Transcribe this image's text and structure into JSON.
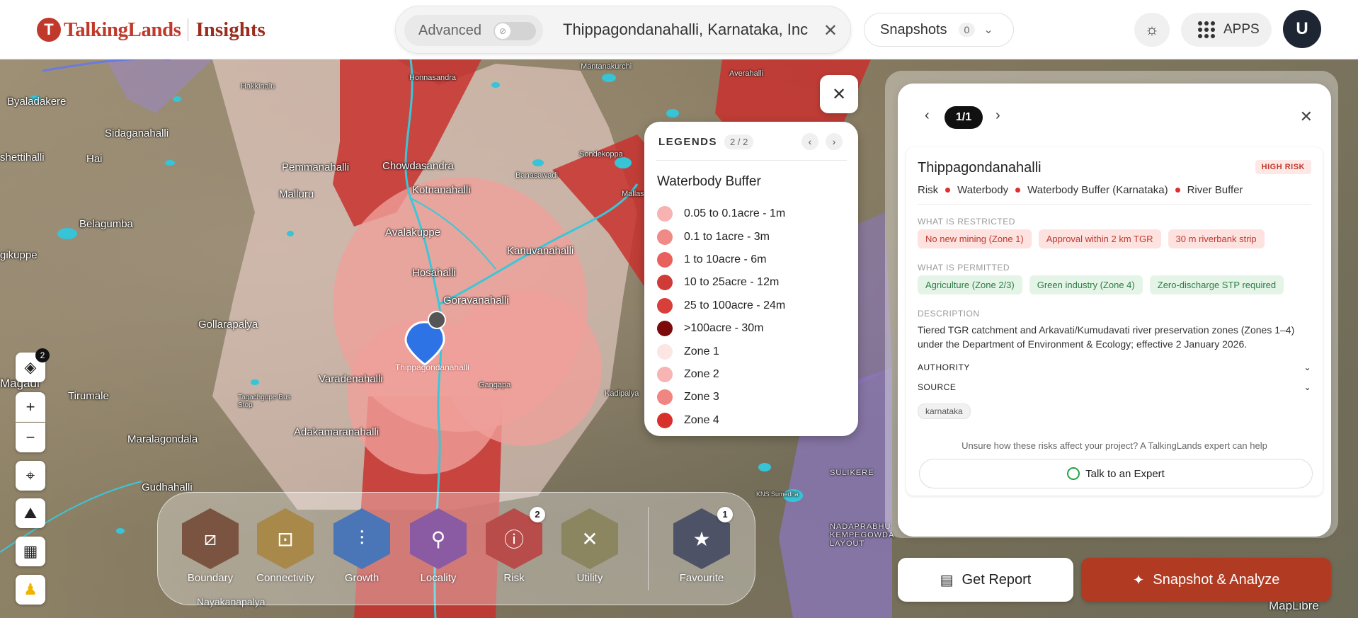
{
  "header": {
    "logo_mark": "T",
    "logo_text": "TalkingLands",
    "logo_sub": "Insights",
    "advanced_label": "Advanced",
    "search_value": "Thippagondanahalli, Karnataka, Inc",
    "snapshots_label": "Snapshots",
    "snapshots_count": "0",
    "apps_label": "APPS",
    "avatar_initial": "U"
  },
  "map": {
    "labels": [
      "Byaladakere",
      "Sidaganahalli",
      "shettihalli",
      "Hai",
      "Belagumba",
      "gikuppe",
      "Gollarapalya",
      "Magadi",
      "Tirumale",
      "Maralagondala",
      "Gudhahalli",
      "Adakamaranahalli",
      "Varadenahalli",
      "Thippagondanahalli",
      "Hosahalli",
      "Goravanahalli",
      "Kanuvanahalli",
      "Avalakuppe",
      "Kotnanahalli",
      "Chowdasandra",
      "Pemmanahalli",
      "Malluru",
      "Honnasandra",
      "Hakkinalu",
      "Averahalli",
      "Banasawadi",
      "Sondekoppa",
      "SULIKERE",
      "NADAPRABHU KEMPEGOWDA LAYOUT",
      "Nayakanapalya",
      "Tagachgupe Bus Stop",
      "Mantanakurchi",
      "Gangapa",
      "Kadipalya",
      "Mallasandra",
      "KNS Sumedha"
    ],
    "attribution": "MapLibre",
    "layers_badge": "2"
  },
  "legend": {
    "title": "LEGENDS",
    "page": "2 / 2",
    "section": "Waterbody Buffer",
    "items": [
      {
        "label": "0.05 to 0.1acre - 1m",
        "color": "#f6b3b1"
      },
      {
        "label": "0.1 to 1acre - 3m",
        "color": "#f08a86"
      },
      {
        "label": "1 to 10acre - 6m",
        "color": "#e9615d"
      },
      {
        "label": "10 to 25acre - 12m",
        "color": "#cf3b37"
      },
      {
        "label": "25 to 100acre - 24m",
        "color": "#d83f3b"
      },
      {
        "label": ">100acre - 30m",
        "color": "#7c0a0a"
      },
      {
        "label": "Zone 1",
        "color": "#fbe6e4"
      },
      {
        "label": "Zone 2",
        "color": "#f6b4b2"
      },
      {
        "label": "Zone 3",
        "color": "#f08581"
      },
      {
        "label": "Zone 4",
        "color": "#d8302d"
      }
    ]
  },
  "panel": {
    "pager": "1/1",
    "title": "Thippagondanahalli",
    "risk_badge": "HIGH RISK",
    "crumbs": [
      "Risk",
      "Waterbody",
      "Waterbody Buffer (Karnataka)",
      "River Buffer"
    ],
    "restricted_label": "WHAT IS RESTRICTED",
    "restricted": [
      "No new mining (Zone 1)",
      "Approval within 2 km TGR",
      "30 m riverbank strip"
    ],
    "permitted_label": "WHAT IS PERMITTED",
    "permitted": [
      "Agriculture (Zone 2/3)",
      "Green industry (Zone 4)",
      "Zero-discharge STP required"
    ],
    "description_label": "DESCRIPTION",
    "description": "Tiered TGR catchment and Arkavati/Kumudavati river preservation zones (Zones 1–4) under the Department of Environment & Ecology; effective 2 January 2026.",
    "authority_label": "AUTHORITY",
    "source_label": "SOURCE",
    "source_tag": "karnataka",
    "help_text": "Unsure how these risks affect your project? A TalkingLands expert can help",
    "talk_label": "Talk to an Expert"
  },
  "actions": {
    "report_label": "Get Report",
    "analyze_label": "Snapshot & Analyze"
  },
  "categories": [
    {
      "label": "Boundary",
      "icon": "boundary-icon",
      "color": "#7a5440",
      "badge": ""
    },
    {
      "label": "Connectivity",
      "icon": "train-icon",
      "color": "#a8894a",
      "badge": ""
    },
    {
      "label": "Growth",
      "icon": "growth-icon",
      "color": "#4a76b8",
      "badge": ""
    },
    {
      "label": "Locality",
      "icon": "locality-icon",
      "color": "#8a5aa2",
      "badge": ""
    },
    {
      "label": "Risk",
      "icon": "alert-icon",
      "color": "#b84c4a",
      "badge": "2"
    },
    {
      "label": "Utility",
      "icon": "tools-icon",
      "color": "#8b8560",
      "badge": ""
    },
    {
      "label": "Favourite",
      "icon": "star-icon",
      "color": "#4d5266",
      "badge": "1"
    }
  ]
}
